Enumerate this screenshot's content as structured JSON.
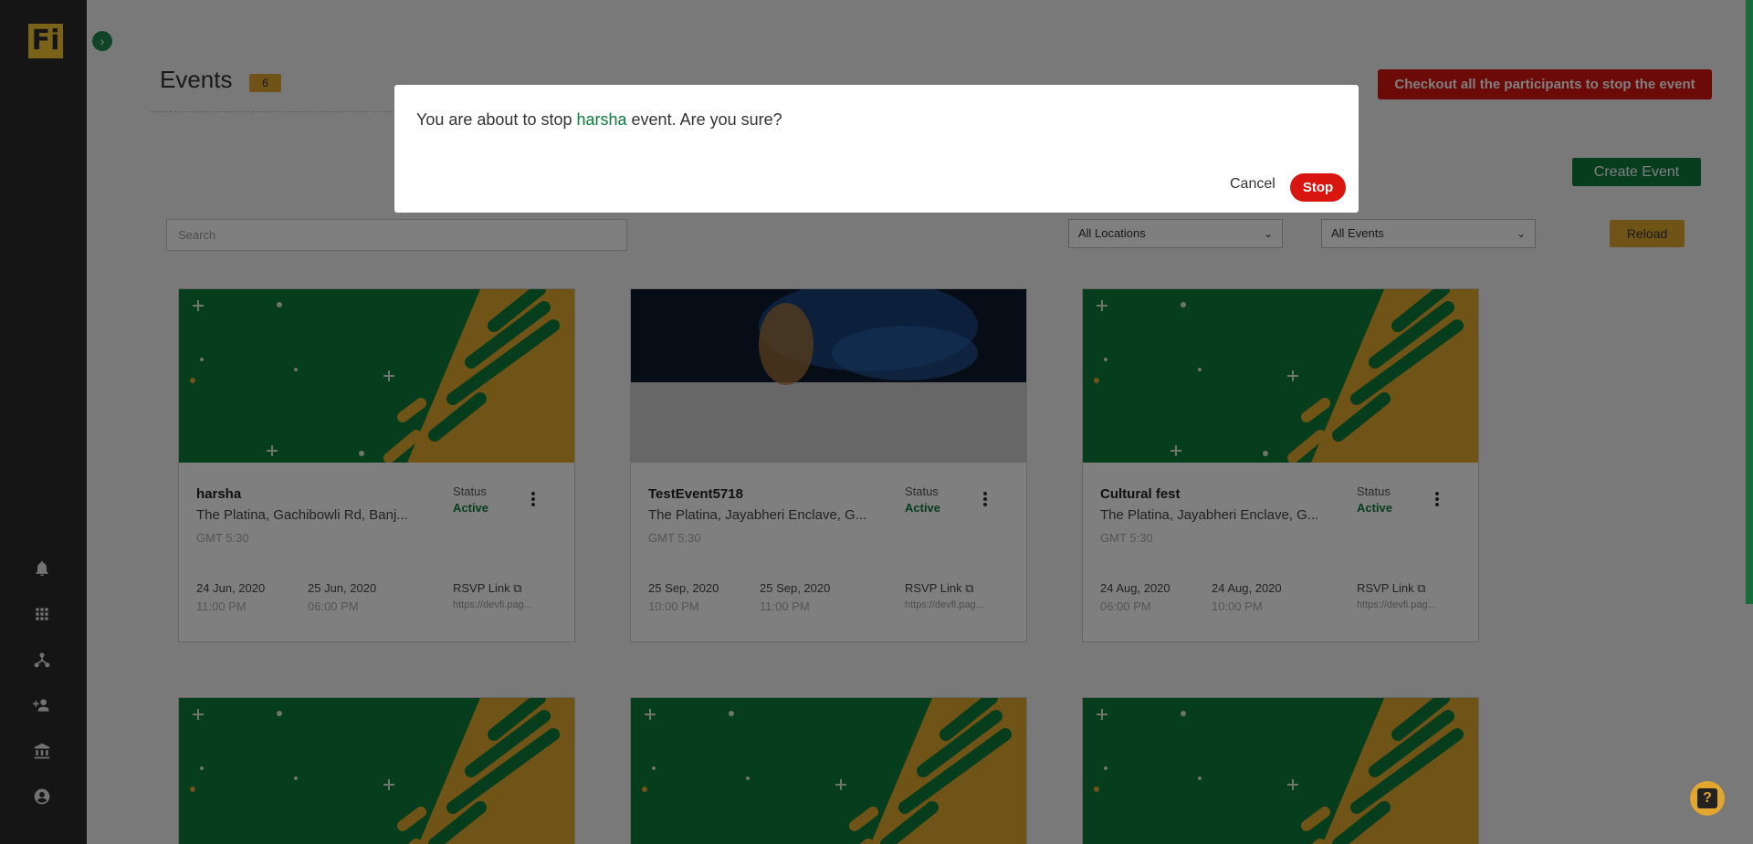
{
  "app": {
    "logo_text": "Fi"
  },
  "sidebar": {
    "icons": [
      "bell-icon",
      "grid-icon",
      "network-icon",
      "add-user-icon",
      "bank-icon",
      "account-icon"
    ]
  },
  "header": {
    "title": "Events",
    "count": "6",
    "checkout_label": "Checkout all the participants to stop the event",
    "create_label": "Create Event"
  },
  "filters": {
    "search_placeholder": "Search",
    "location_selected": "All Locations",
    "event_selected": "All Events",
    "reload_label": "Reload"
  },
  "events": [
    {
      "name": "harsha",
      "location": "The Platina, Gachibowli Rd, Banj...",
      "tz": "GMT 5:30",
      "status_label": "Status",
      "status": "Active",
      "start_date": "24 Jun, 2020",
      "start_time": "11:00 PM",
      "end_date": "25 Jun, 2020",
      "end_time": "06:00 PM",
      "rsvp_label": "RSVP Link",
      "rsvp_url": "https://devfi.pag..."
    },
    {
      "name": "TestEvent5718",
      "location": "The Platina, Jayabheri Enclave, G...",
      "tz": "GMT 5:30",
      "status_label": "Status",
      "status": "Active",
      "start_date": "25 Sep, 2020",
      "start_time": "10:00 PM",
      "end_date": "25 Sep, 2020",
      "end_time": "11:00 PM",
      "rsvp_label": "RSVP Link",
      "rsvp_url": "https://devfi.pag..."
    },
    {
      "name": "Cultural fest",
      "location": "The Platina, Jayabheri Enclave, G...",
      "tz": "GMT 5:30",
      "status_label": "Status",
      "status": "Active",
      "start_date": "24 Aug, 2020",
      "start_time": "06:00 PM",
      "end_date": "24 Aug, 2020",
      "end_time": "10:00 PM",
      "rsvp_label": "RSVP Link",
      "rsvp_url": "https://devfi.pag..."
    }
  ],
  "modal": {
    "prefix": "You are about to stop ",
    "event_name": "harsha",
    "suffix": " event. Are you sure?",
    "cancel_label": "Cancel",
    "stop_label": "Stop"
  },
  "help": {
    "glyph": "?"
  },
  "colors": {
    "brand_green": "#0b7a3a",
    "brand_gold": "#e0a62e",
    "danger": "#d9150f"
  }
}
